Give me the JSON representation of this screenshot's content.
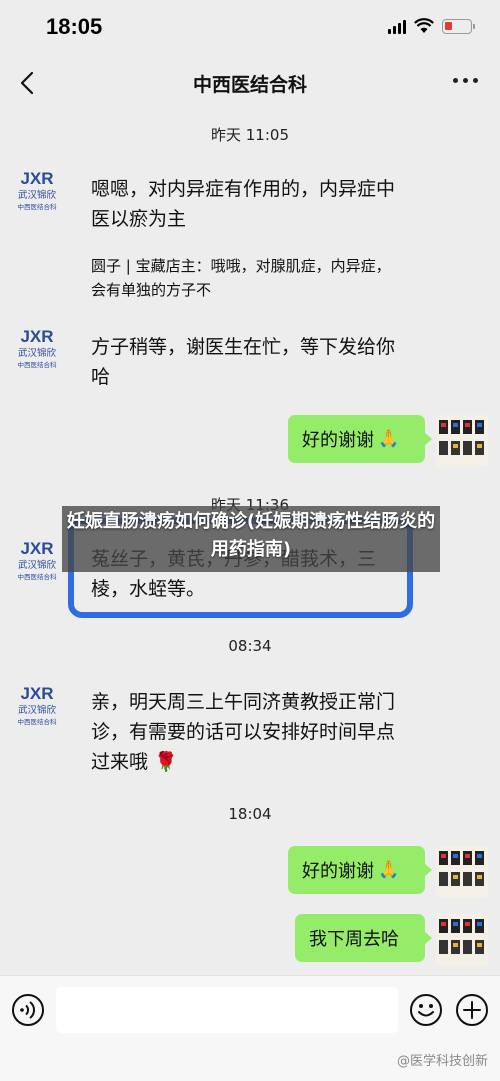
{
  "status_bar": {
    "time": "18:05"
  },
  "nav": {
    "title": "中西医结合科"
  },
  "brand": {
    "logo_text": "JXR",
    "name_line1": "武汉锦欣",
    "name_line2": "中西医结合科"
  },
  "messages": {
    "t1": "昨天 11:05",
    "m1": "嗯嗯，对内异症有作用的，内异症中医以瘀为主",
    "m1_quote": "圆子 | 宝藏店主：哦哦，对腺肌症，内异症，会有单独的方子不",
    "m2": "方子稍等，谢医生在忙，等下发给你哈",
    "r1": "好的谢谢",
    "t2": "昨天 11:36",
    "m3": "菟丝子，黄芪，丹参，醋莪术，三棱，水蛭等。",
    "t3": "08:34",
    "m4": "亲，明天周三上午同济黄教授正常门诊，有需要的话可以安排好时间早点过来哦",
    "t4": "18:04",
    "r2": "好的谢谢",
    "r3": "我下周去哈"
  },
  "overlay": {
    "banner_text": "妊娠直肠溃疡如何确诊(妊娠期溃疡性结肠炎的用药指南)"
  },
  "input": {
    "placeholder": ""
  },
  "watermark": {
    "text": "@医学科技创新"
  },
  "icons": [
    "back-arrow-icon",
    "more-dots-icon",
    "voice-icon",
    "emoji-icon",
    "plus-icon",
    "praying-hands-emoji",
    "rose-emoji"
  ],
  "colors": {
    "bubble_green": "#95ec69",
    "highlight_blue": "#2f6de2",
    "background": "#ededed"
  }
}
